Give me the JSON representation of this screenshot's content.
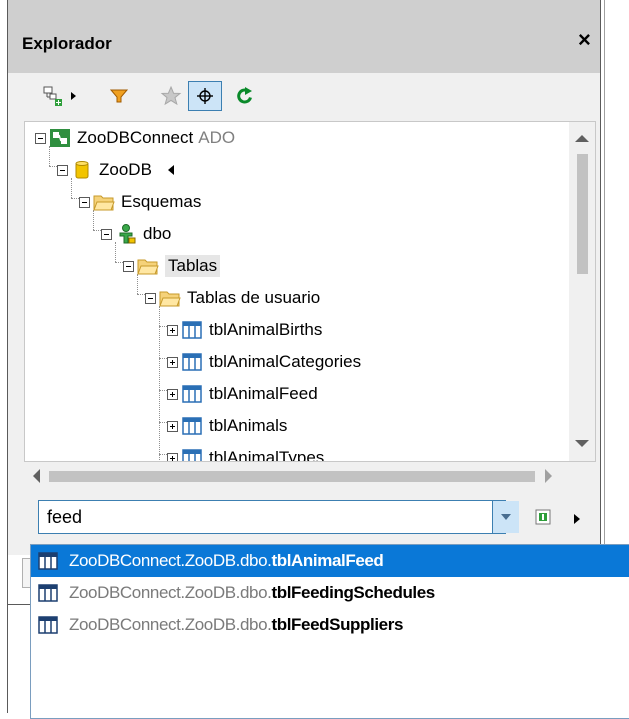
{
  "panel": {
    "title": "Explorador",
    "close_label": "×"
  },
  "toolbar": {
    "buttons": [
      "add-connection",
      "filter",
      "favorites",
      "locate",
      "refresh"
    ],
    "active": "locate"
  },
  "tree": {
    "connection": {
      "label": "ZooDBConnect",
      "suffix": "ADO"
    },
    "database": {
      "label": "ZooDB"
    },
    "schemas_folder": {
      "label": "Esquemas"
    },
    "schema": {
      "label": "dbo"
    },
    "tables_folder": {
      "label": "Tablas"
    },
    "user_tables_folder": {
      "label": "Tablas de usuario"
    },
    "tables": [
      "tblAnimalBirths",
      "tblAnimalCategories",
      "tblAnimalFeed",
      "tblAnimals",
      "tblAnimalTypes"
    ]
  },
  "search": {
    "value": "feed"
  },
  "results": {
    "prefix": "ZooDBConnect.ZooDB.dbo.",
    "items": [
      "tblAnimalFeed",
      "tblFeedingSchedules",
      "tblFeedSuppliers"
    ],
    "selected_index": 0
  },
  "colors": {
    "selection": "#0a78d7",
    "header": "#cfcfcf",
    "accent": "#3c7fb1"
  }
}
